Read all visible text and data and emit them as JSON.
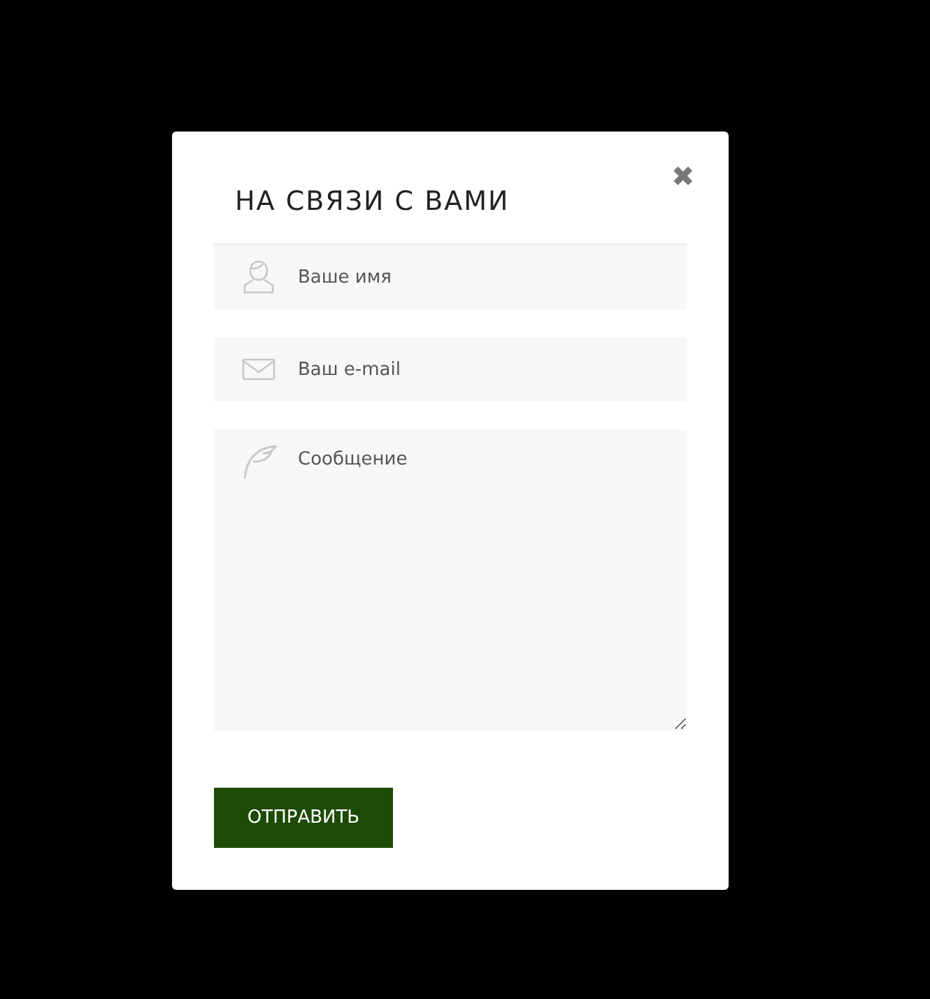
{
  "dialog": {
    "title": "НА СВЯЗИ С ВАМИ",
    "close": "✖"
  },
  "fields": [
    {
      "kind": "name",
      "placeholder": "Ваше имя"
    },
    {
      "kind": "email",
      "placeholder": "Ваш e-mail"
    },
    {
      "kind": "message",
      "placeholder": "Сообщение"
    }
  ],
  "submit": "ОТПРАВИТЬ"
}
